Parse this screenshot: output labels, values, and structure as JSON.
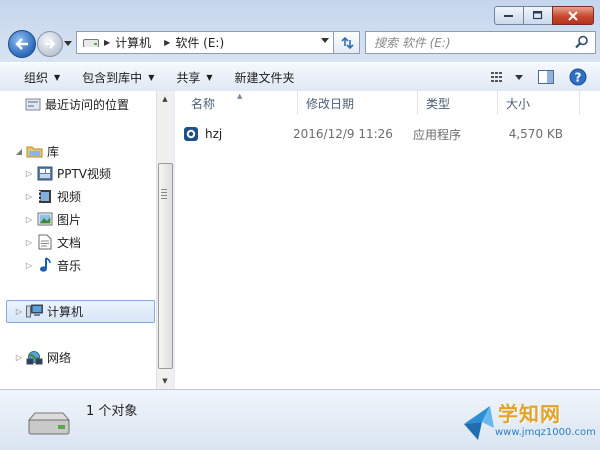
{
  "nav": {
    "breadcrumb": [
      "计算机",
      "软件 (E:)"
    ]
  },
  "search": {
    "placeholder": "搜索 软件 (E:)"
  },
  "commandbar": {
    "organize": "组织",
    "include_in_library": "包含到库中",
    "share": "共享",
    "new_folder": "新建文件夹"
  },
  "sidebar": {
    "recent": "最近访问的位置",
    "libraries": "库",
    "pptv": "PPTV视频",
    "videos": "视频",
    "pictures": "图片",
    "documents": "文档",
    "music": "音乐",
    "computer": "计算机",
    "network": "网络"
  },
  "columns": {
    "name": "名称",
    "date": "修改日期",
    "type": "类型",
    "size": "大小"
  },
  "files": [
    {
      "name": "hzj",
      "date": "2016/12/9 11:26",
      "type": "应用程序",
      "size": "4,570 KB"
    }
  ],
  "status": {
    "count": "1 个对象"
  },
  "watermark": {
    "title": "学知网",
    "url": "www.jmqz1000.com"
  },
  "colors": {
    "accent": "#2b68b8",
    "selection": "#d7e6f9"
  }
}
